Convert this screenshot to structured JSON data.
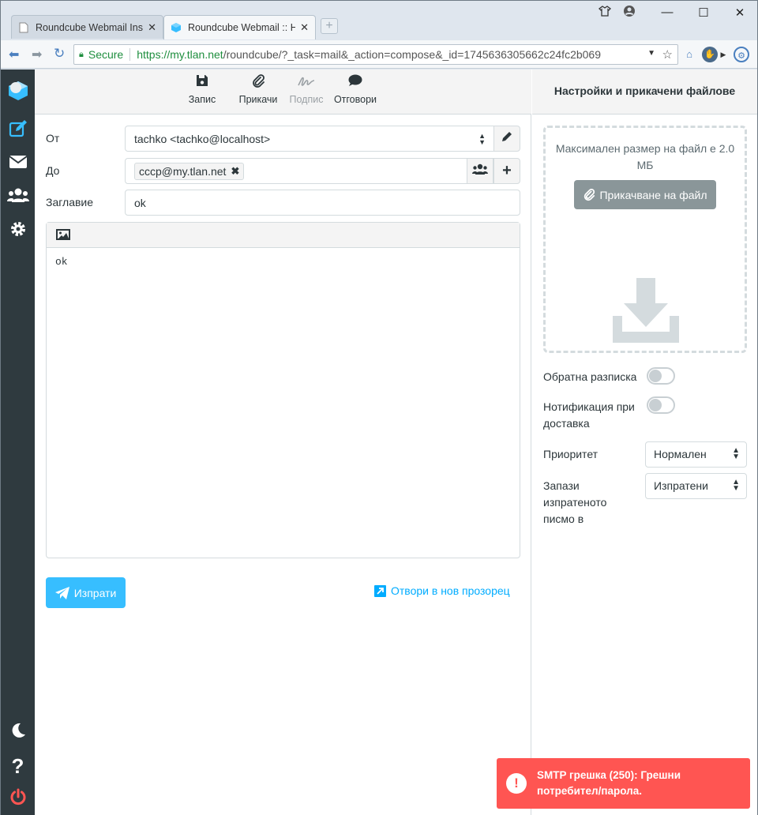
{
  "browser": {
    "tabs": [
      {
        "title": "Roundcube Webmail Inst",
        "active": false
      },
      {
        "title": "Roundcube Webmail :: H",
        "active": true
      }
    ],
    "secure_label": "Secure",
    "url_host": "https://my.tlan.net",
    "url_path": "/roundcube/?_task=mail&_action=compose&_id=1745636305662c24fc2b069"
  },
  "toolbar": {
    "save": "Запис",
    "attach": "Прикачи",
    "signature": "Подпис",
    "responses": "Отговори"
  },
  "form": {
    "from_label": "От",
    "from_value": "tachko <tachko@localhost>",
    "to_label": "До",
    "to_recipient": "cccp@my.tlan.net",
    "subject_label": "Заглавие",
    "subject_value": "ok",
    "body": "ok"
  },
  "actions": {
    "send": "Изпрати",
    "open_new_window": "Отвори в нов прозорец"
  },
  "panel": {
    "title": "Настройки и прикачени файлове",
    "max_size": "Максимален размер на файл е 2.0 МБ",
    "attach_button": "Прикачване на файл",
    "return_receipt": "Обратна разписка",
    "delivery_notification": "Нотификация при доставка",
    "priority_label": "Приоритет",
    "priority_value": "Нормален",
    "save_sent_label": "Запази изпратеното писмо в",
    "save_sent_value": "Изпратени"
  },
  "toast": {
    "message": "SMTP грешка (250): Грешни потребител/парола."
  },
  "colors": {
    "accent": "#37beff",
    "link": "#00acff",
    "error": "#ff5552",
    "sidebar": "#2f3a3f"
  }
}
